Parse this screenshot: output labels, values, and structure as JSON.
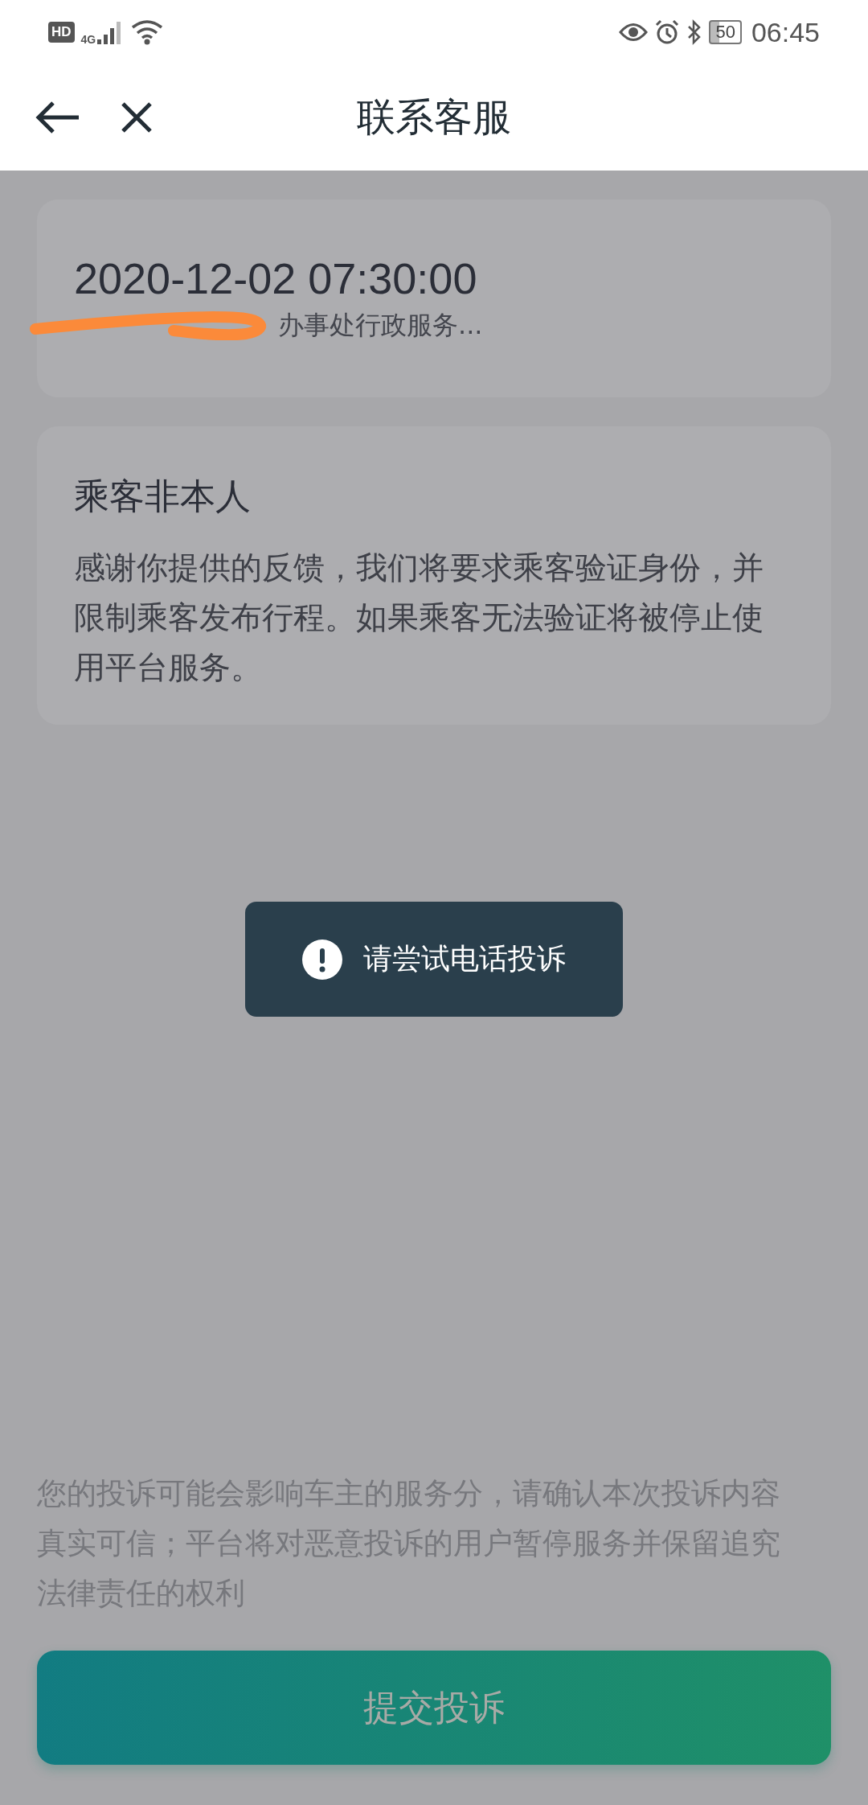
{
  "status_bar": {
    "hd_badge": "HD",
    "network": "4G",
    "battery": "50",
    "time": "06:45"
  },
  "header": {
    "title": "联系客服"
  },
  "trip": {
    "datetime": "2020-12-02 07:30:00",
    "address": "办事处行政服务..."
  },
  "result": {
    "title": "乘客非本人",
    "body": "感谢你提供的反馈，我们将要求乘客验证身份，并限制乘客发布行程。如果乘客无法验证将被停止使用平台服务。"
  },
  "toast": {
    "text": "请尝试电话投诉"
  },
  "notice": "您的投诉可能会影响车主的服务分，请确认本次投诉内容真实可信；平台将对恶意投诉的用户暂停服务并保留追究法律责任的权利",
  "submit_button": {
    "label": "提交投诉"
  }
}
